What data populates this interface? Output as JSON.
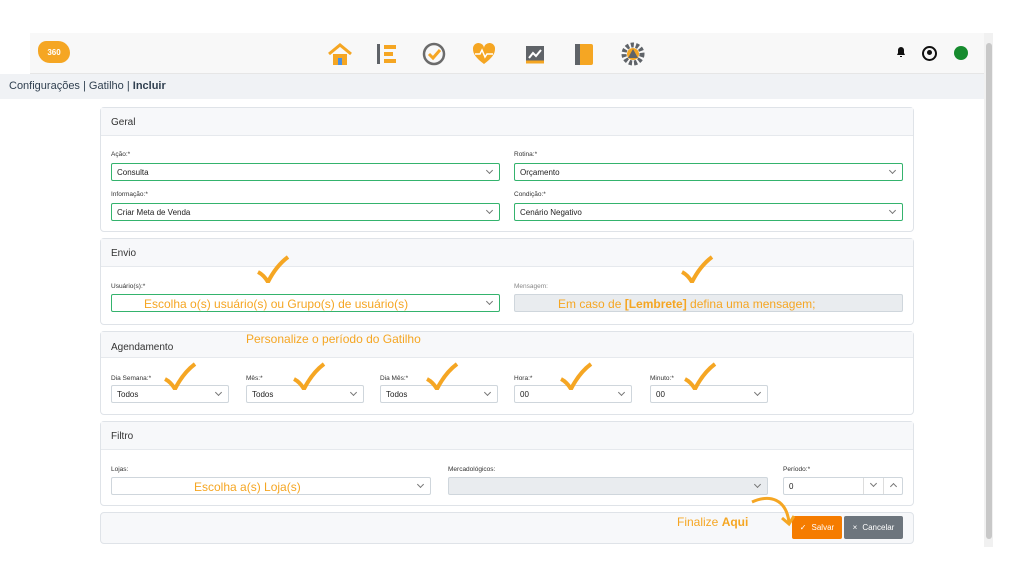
{
  "brand": {
    "logo_text": "360"
  },
  "header": {
    "icons": [
      "home-icon",
      "timeline-icon",
      "check-circle-icon",
      "heart-pulse-icon",
      "chart-icon",
      "book-icon",
      "gear-icon"
    ],
    "right": [
      "bell-icon",
      "user-icon",
      "status-icon"
    ]
  },
  "breadcrumb": {
    "a": "Configurações",
    "b": "Gatilho",
    "c": "Incluir",
    "sep": "|"
  },
  "geral": {
    "title": "Geral",
    "acao_label": "Ação:*",
    "acao": "Consulta",
    "rotina_label": "Rotina:*",
    "rotina": "Orçamento",
    "info_label": "Informação:*",
    "info": "Criar Meta de Venda",
    "cond_label": "Condição:*",
    "cond": "Cenário Negativo"
  },
  "envio": {
    "title": "Envio",
    "usuarios_label": "Usuário(s):*",
    "usuarios_hint": "Escolha o(s) usuário(s) ou Grupo(s) de usuário(s)",
    "mensagem_label": "Mensagem:",
    "mensagem_prefix": "Em caso de ",
    "mensagem_bold": "[Lembrete]",
    "mensagem_suffix": " defina uma mensagem;"
  },
  "agendamento": {
    "title": "Agendamento",
    "hint": "Personalize o período do Gatilho",
    "dia_semana_label": "Dia Semana:*",
    "dia_semana": "Todos",
    "mes_label": "Mês:*",
    "mes": "Todos",
    "dia_mes_label": "Dia Mês:*",
    "dia_mes": "Todos",
    "hora_label": "Hora:*",
    "hora": "00",
    "minuto_label": "Minuto:*",
    "minuto": "00"
  },
  "filtro": {
    "title": "Filtro",
    "lojas_label": "Lojas:",
    "lojas_hint": "Escolha a(s) Loja(s)",
    "merc_label": "Mercadológicos:",
    "periodo_label": "Período:*",
    "periodo": "0"
  },
  "footer": {
    "finalize_text": "Finalize ",
    "finalize_bold": "Aqui",
    "save_label": "Salvar",
    "cancel_label": "Cancelar"
  },
  "colors": {
    "accent": "#f5a623",
    "orange": "#f57c00",
    "green": "#34b36d"
  }
}
